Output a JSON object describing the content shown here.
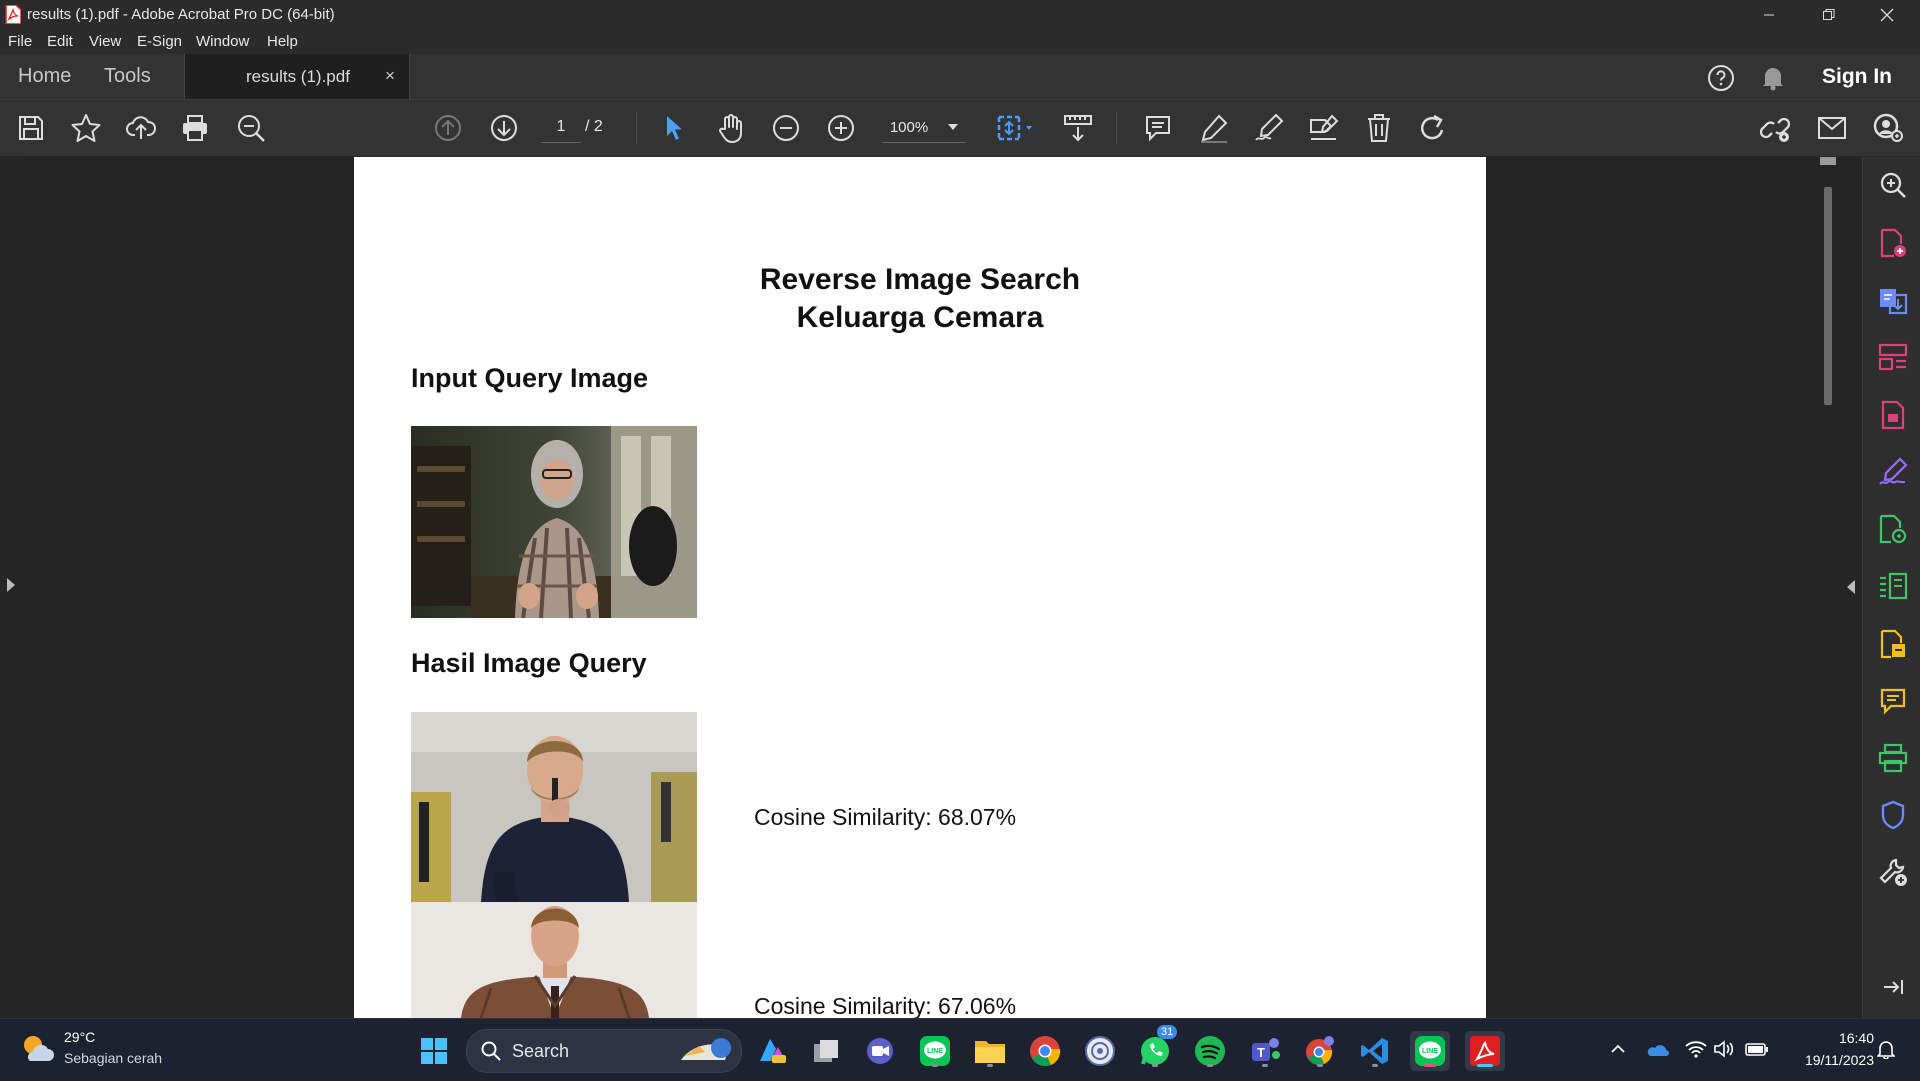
{
  "window": {
    "title": "results (1).pdf - Adobe Acrobat Pro DC (64-bit)"
  },
  "menu": [
    "File",
    "Edit",
    "View",
    "E-Sign",
    "Window",
    "Help"
  ],
  "tabs": {
    "home": "Home",
    "tools": "Tools",
    "document": "results (1).pdf",
    "close": "×",
    "signin": "Sign In"
  },
  "toolbar": {
    "page_current": "1",
    "page_total": "/ 2",
    "zoom": "100%"
  },
  "document": {
    "title_line1": "Reverse Image Search",
    "title_line2": "Keluarga Cemara",
    "input_heading": "Input Query Image",
    "results_heading": "Hasil Image Query",
    "results": [
      {
        "label": "Cosine Similarity: 68.07%"
      },
      {
        "label": "Cosine Similarity: 67.06%"
      }
    ]
  },
  "taskbar": {
    "weather_temp": "29°C",
    "weather_desc": "Sebagian cerah",
    "search_label": "Search",
    "time": "16:40",
    "date": "19/11/2023",
    "whatsapp_badge": "31"
  },
  "colors": {
    "accent_blue": "#4a9eff",
    "acrobat_red": "#e02020",
    "rail_pink": "#e0407a",
    "rail_purple": "#9b6bff",
    "rail_green": "#3fc46a",
    "rail_yellow": "#f2c018"
  }
}
